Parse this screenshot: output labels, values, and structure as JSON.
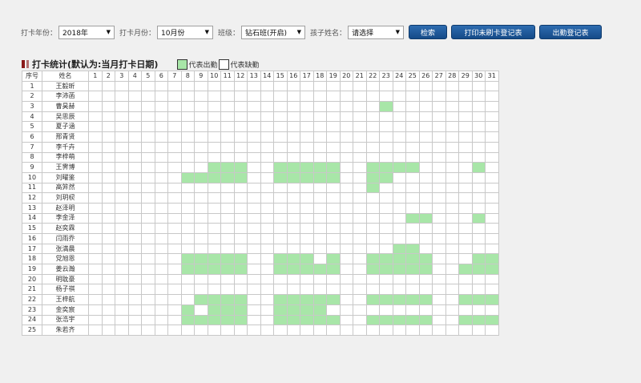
{
  "filters": {
    "year_label": "打卡年份：",
    "year_value": "2018年",
    "month_label": "打卡月份：",
    "month_value": "10月份",
    "class_label": "班级：",
    "class_value": "钻石班(开启)",
    "child_label": "孩子姓名：",
    "child_value": "请选择"
  },
  "buttons": {
    "search": "检索",
    "print_unswiped": "打印未刷卡登记表",
    "attendance_register": "出勤登记表"
  },
  "section": {
    "title": "打卡统计(默认为:当月打卡日期)",
    "legend_present": "代表出勤",
    "legend_absent": "代表缺勤"
  },
  "colors": {
    "present": "#a8e6a8",
    "button": "#1f5c9e",
    "title_mark": "#8b1a1a"
  },
  "table": {
    "col_index": "序号",
    "col_name": "姓名",
    "days": [
      "1",
      "2",
      "3",
      "4",
      "5",
      "6",
      "7",
      "8",
      "9",
      "10",
      "11",
      "12",
      "13",
      "14",
      "15",
      "16",
      "17",
      "18",
      "19",
      "20",
      "21",
      "22",
      "23",
      "24",
      "25",
      "26",
      "27",
      "28",
      "29",
      "30",
      "31"
    ],
    "rows": [
      {
        "no": "1",
        "name": "王毅昕",
        "present": []
      },
      {
        "no": "2",
        "name": "李沛菡",
        "present": []
      },
      {
        "no": "3",
        "name": "曹昊赫",
        "present": [
          23
        ]
      },
      {
        "no": "4",
        "name": "吴思辰",
        "present": []
      },
      {
        "no": "5",
        "name": "夏子涵",
        "present": []
      },
      {
        "no": "6",
        "name": "邢青贤",
        "present": []
      },
      {
        "no": "7",
        "name": "李千卉",
        "present": []
      },
      {
        "no": "8",
        "name": "李梓萌",
        "present": []
      },
      {
        "no": "9",
        "name": "王霁博",
        "present": [
          10,
          11,
          12,
          15,
          16,
          17,
          18,
          19,
          22,
          23,
          24,
          25,
          30
        ]
      },
      {
        "no": "10",
        "name": "刘曜鉴",
        "present": [
          8,
          9,
          10,
          11,
          12,
          15,
          16,
          17,
          18,
          19,
          22,
          23
        ]
      },
      {
        "no": "11",
        "name": "高笄然",
        "present": [
          22
        ]
      },
      {
        "no": "12",
        "name": "刘玥棂",
        "present": []
      },
      {
        "no": "13",
        "name": "赵泽明",
        "present": []
      },
      {
        "no": "14",
        "name": "李金泽",
        "present": [
          25,
          26,
          30
        ]
      },
      {
        "no": "15",
        "name": "赵奕霖",
        "present": []
      },
      {
        "no": "16",
        "name": "闫雨乔",
        "present": []
      },
      {
        "no": "17",
        "name": "张満晨",
        "present": [
          24,
          25
        ]
      },
      {
        "no": "18",
        "name": "党旭恩",
        "present": [
          8,
          9,
          10,
          11,
          12,
          15,
          16,
          17,
          19,
          22,
          23,
          24,
          25,
          26,
          30,
          31
        ]
      },
      {
        "no": "19",
        "name": "姜云瀚",
        "present": [
          8,
          9,
          10,
          11,
          12,
          15,
          16,
          17,
          18,
          19,
          22,
          23,
          24,
          25,
          26,
          29,
          30,
          31
        ]
      },
      {
        "no": "20",
        "name": "明耽豪",
        "present": []
      },
      {
        "no": "21",
        "name": "杨子祺",
        "present": []
      },
      {
        "no": "22",
        "name": "王梓航",
        "present": [
          9,
          10,
          11,
          12,
          15,
          16,
          17,
          18,
          19,
          22,
          23,
          24,
          25,
          26,
          29,
          30,
          31
        ]
      },
      {
        "no": "23",
        "name": "金奕宸",
        "present": [
          8,
          10,
          11,
          12,
          15,
          16,
          17,
          18
        ]
      },
      {
        "no": "24",
        "name": "张浩宇",
        "present": [
          8,
          9,
          10,
          11,
          12,
          15,
          16,
          17,
          18,
          19,
          22,
          23,
          24,
          25,
          26,
          29,
          30,
          31
        ]
      },
      {
        "no": "25",
        "name": "朱若齐",
        "present": []
      }
    ]
  }
}
